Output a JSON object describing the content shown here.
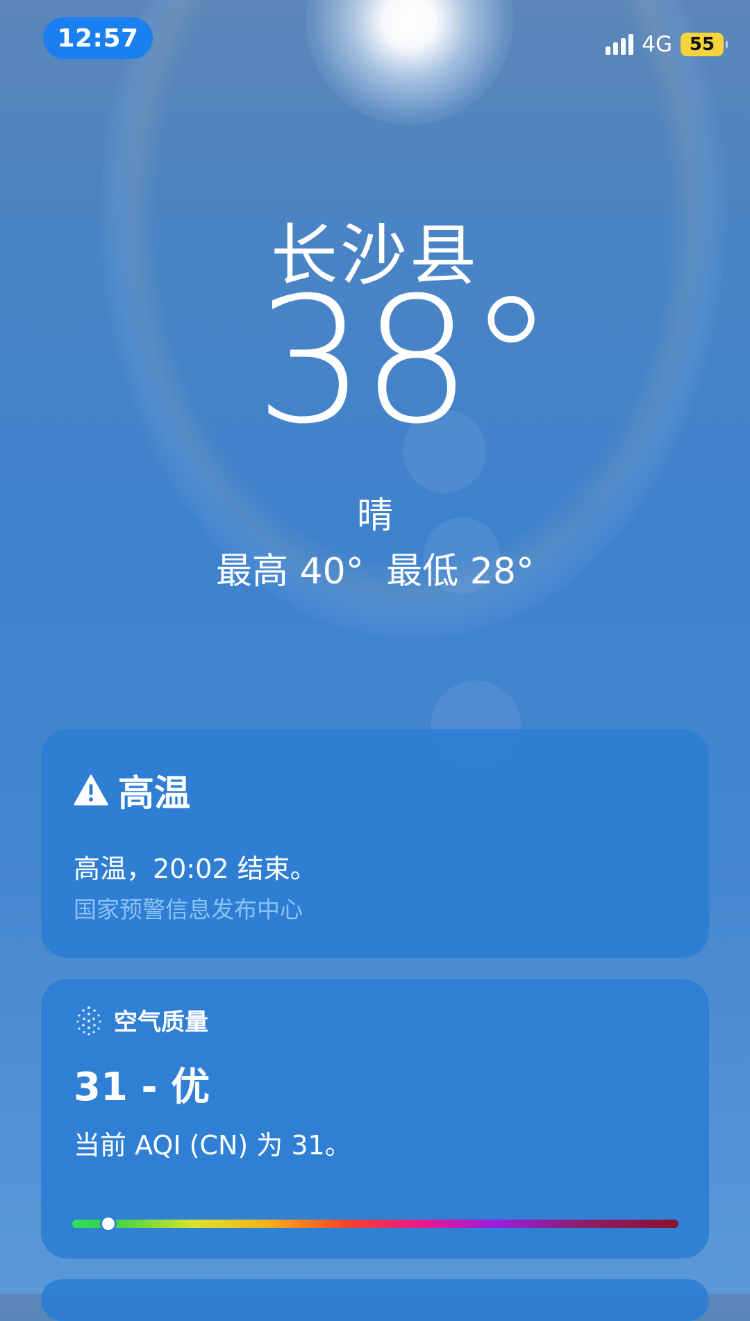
{
  "status_bar": {
    "time": "12:57",
    "network": "4G",
    "battery": "55",
    "battery_color": "#f5d33a",
    "time_pill_color": "#1a80f0"
  },
  "weather": {
    "city": "长沙县",
    "temperature": "38°",
    "condition": "晴",
    "high": "最高 40°",
    "low": "最低 28°"
  },
  "alert_card": {
    "icon": "warning-triangle-icon",
    "title": "高温",
    "message": "高温，20:02 结束。",
    "source": "国家预警信息发布中心"
  },
  "air_quality_card": {
    "icon": "air-quality-dots-icon",
    "header": "空气质量",
    "value": "31 - 优",
    "description": "当前 AQI (CN) 为 31。",
    "aqi_level_fraction": 0.06,
    "scale_colors": [
      "#2fe05a",
      "#d9e42b",
      "#f7b21b",
      "#f2442b",
      "#e61a8d",
      "#9a1ee0",
      "#8a1330"
    ]
  }
}
